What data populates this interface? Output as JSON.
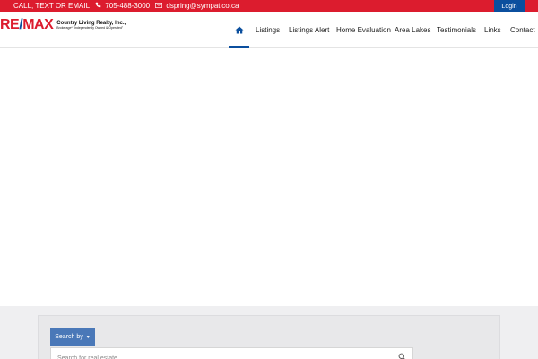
{
  "topbar": {
    "cta": "CALL, TEXT OR EMAIL",
    "phone": "705-488-3000",
    "email": "dspring@sympatico.ca",
    "login_label": "Login",
    "bg_color": "#dc1c2e",
    "login_color": "#0b4f9e"
  },
  "brand": {
    "logo_mark_re": "RE",
    "logo_mark_slash": "/",
    "logo_mark_max": "MAX",
    "company_name": "Country Living Realty, Inc.,",
    "tagline": "Brokerage* \"Independently Owned & Operated\""
  },
  "nav": {
    "home_icon": "home-icon",
    "items": [
      "Listings",
      "Listings Alert",
      "Home Evaluation",
      "Area Lakes",
      "Testimonials",
      "Links",
      "Contact"
    ],
    "active": "home"
  },
  "search": {
    "search_by_label": "Search by",
    "placeholder": "Search for real estate",
    "icon": "search-icon"
  }
}
